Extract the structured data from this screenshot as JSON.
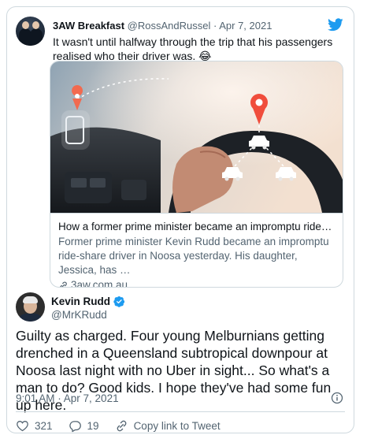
{
  "quoted_tweet": {
    "author_name": "3AW Breakfast",
    "handle": "@RossAndRussel",
    "separator": "·",
    "date": "Apr 7, 2021",
    "text": "It wasn't until halfway through the trip that his passengers realised who their driver was. 😂"
  },
  "link_card": {
    "title": "How a former prime minister became an impromptu ride-shar…",
    "description": "Former prime minister Kevin Rudd became an impromptu ride-share driver in Noosa yesterday. His daughter, Jessica, has …",
    "domain": "3aw.com.au"
  },
  "tweet": {
    "author_name": "Kevin Rudd",
    "handle": "@MrKRudd",
    "text": "Guilty as charged. Four young Melburnians getting drenched in a Queensland subtropical downpour at Noosa last night with no Uber in sight... So what's a man to do? Good kids. I hope they've had some fun up here.",
    "time": "9:01 AM · Apr 7, 2021"
  },
  "actions": {
    "likes": "321",
    "replies": "19",
    "copy_link_label": "Copy link to Tweet"
  },
  "colors": {
    "twitter_blue": "#1d9bf0",
    "like_red": "#f91880",
    "border": "#cfd9de",
    "secondary_text": "#536471"
  }
}
